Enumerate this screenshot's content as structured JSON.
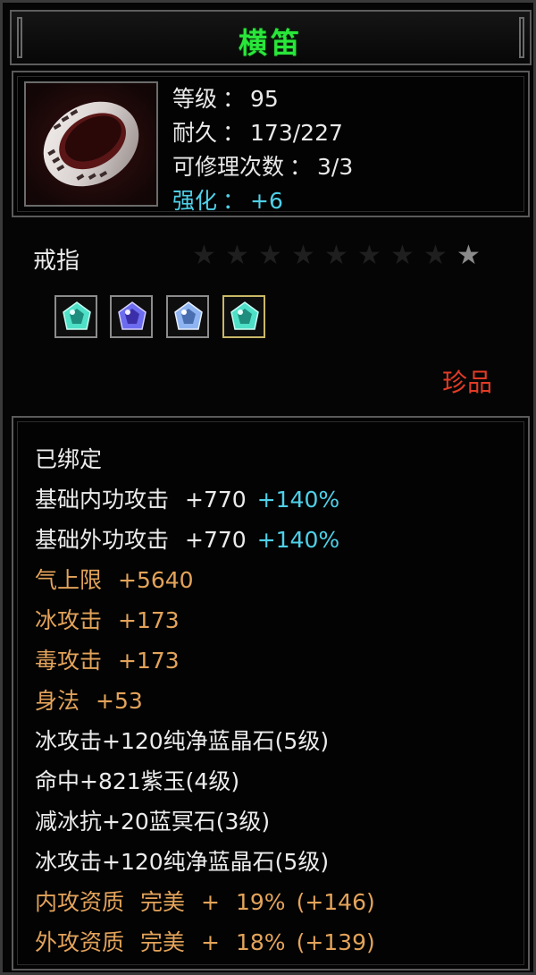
{
  "title": "横笛",
  "header": {
    "level": {
      "label": "等级",
      "sep": "：",
      "value": "95"
    },
    "durability": {
      "label": "耐久",
      "sep": "：",
      "value": "173/227"
    },
    "repair": {
      "label": "可修理次数",
      "sep": "：",
      "value": "3/3"
    },
    "enhance": {
      "label": "强化",
      "sep": "：",
      "value": "+6"
    }
  },
  "item_type": "戒指",
  "stars": {
    "total": 9,
    "lit": 1
  },
  "gems": [
    {
      "name": "cyan-gem-icon",
      "color": "#4fe0c8"
    },
    {
      "name": "purple-gem-icon",
      "color": "#6c6cf0"
    },
    {
      "name": "blue-gem-icon",
      "color": "#8fb4f2"
    },
    {
      "name": "cyan-gem-icon",
      "color": "#4fe0c8"
    }
  ],
  "rarity": "珍品",
  "bound": "已绑定",
  "attributes": [
    {
      "label": "基础内功攻击",
      "value": "+770",
      "bonus": "+140%"
    },
    {
      "label": "基础外功攻击",
      "value": "+770",
      "bonus": "+140%"
    }
  ],
  "bonus_stats": [
    {
      "label": "气上限",
      "value": "+5640"
    },
    {
      "label": "冰攻击",
      "value": "+173"
    },
    {
      "label": "毒攻击",
      "value": "+173"
    },
    {
      "label": "身法",
      "value": "+53"
    }
  ],
  "gem_effects": [
    "冰攻击+120纯净蓝晶石(5级)",
    "命中+821紫玉(4级)",
    "减冰抗+20蓝冥石(3级)",
    "冰攻击+120纯净蓝晶石(5级)"
  ],
  "qualities": [
    {
      "label": "内攻资质",
      "grade": "完美",
      "plus": "+",
      "percent": "19%",
      "extra": "(+146)"
    },
    {
      "label": "外攻资质",
      "grade": "完美",
      "plus": "+",
      "percent": "18%",
      "extra": "(+139)"
    }
  ],
  "colors": {
    "title": "#29e63a",
    "enhance": "#4fd0e8",
    "rarity": "#e23b26",
    "bonus": "#e3a35a"
  }
}
